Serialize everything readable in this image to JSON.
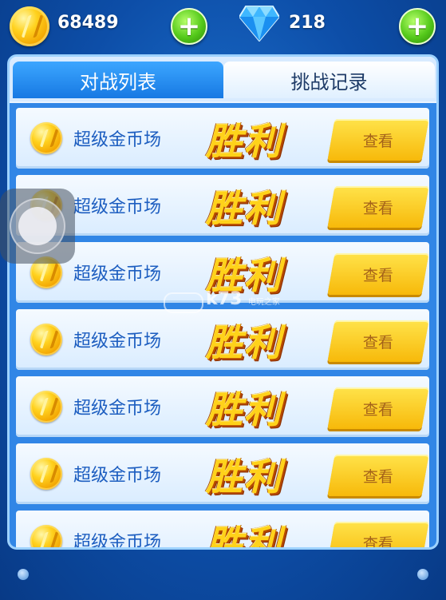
{
  "currency": {
    "coins": {
      "value": "68489",
      "icon": "gold-coin-icon",
      "add_icon": "plus-icon"
    },
    "gems": {
      "value": "218",
      "icon": "blue-diamond-icon",
      "add_icon": "plus-icon"
    }
  },
  "tabs": [
    {
      "label": "对战列表",
      "active": true
    },
    {
      "label": "挑战记录",
      "active": false
    }
  ],
  "rows": [
    {
      "name": "超级金币场",
      "result": "胜利",
      "button": "查看"
    },
    {
      "name": "超级金币场",
      "result": "胜利",
      "button": "查看"
    },
    {
      "name": "超级金币场",
      "result": "胜利",
      "button": "查看"
    },
    {
      "name": "超级金币场",
      "result": "胜利",
      "button": "查看"
    },
    {
      "name": "超级金币场",
      "result": "胜利",
      "button": "查看"
    },
    {
      "name": "超级金币场",
      "result": "胜利",
      "button": "查看"
    },
    {
      "name": "超级金币场",
      "result": "胜利",
      "button": "查看"
    }
  ],
  "watermark": {
    "text": "k73",
    "subtext": "电玩之家"
  },
  "colors": {
    "background": "#0d4ea8",
    "accent_gold": "#ffd21a",
    "tab_active": "#1779e3",
    "row_text": "#1d5ec0",
    "plus_green": "#54c91a"
  }
}
